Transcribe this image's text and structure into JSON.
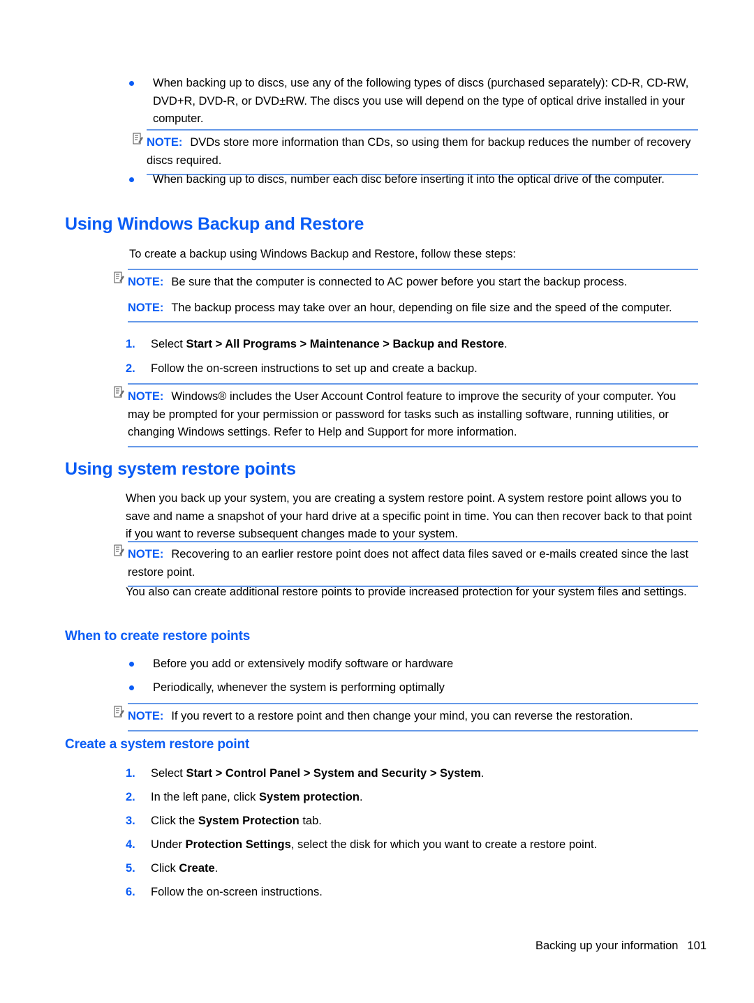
{
  "document": {
    "heading_color": "#0a5cf5",
    "note_border_color": "#6699e8",
    "bullets_top": [
      "When backing up to discs, use any of the following types of discs (purchased separately): CD-R, CD-RW, DVD+R, DVD-R, or DVD±RW. The discs you use will depend on the type of optical drive installed in your computer.",
      "When backing up to discs, number each disc before inserting it into the optical drive of the computer."
    ],
    "note_1": {
      "label": "NOTE:",
      "text": "DVDs store more information than CDs, so using them for backup reduces the number of recovery discs required.",
      "icon": "note-pencil-icon"
    },
    "section_backup_restore": {
      "title": "Using Windows Backup and Restore",
      "intro": "To create a backup using Windows Backup and Restore, follow these steps:",
      "note_a": {
        "label": "NOTE:",
        "text": "Be sure that the computer is connected to AC power before you start the backup process."
      },
      "note_b": {
        "label": "NOTE:",
        "text": "The backup process may take over an hour, depending on file size and the speed of the computer."
      },
      "steps": [
        {
          "number": "1.",
          "prefix": "Select ",
          "bold": "Start > All Programs > Maintenance > Backup and Restore",
          "suffix": "."
        },
        {
          "number": "2.",
          "prefix": "Follow the on-screen instructions to set up and create a backup.",
          "bold": "",
          "suffix": ""
        }
      ],
      "note_c": {
        "label": "NOTE:",
        "text": "Windows® includes the User Account Control feature to improve the security of your computer. You may be prompted for your permission or password for tasks such as installing software, running utilities, or changing Windows settings. Refer to Help and Support for more information."
      }
    },
    "section_restore_points": {
      "title": "Using system restore points",
      "para_1": "When you back up your system, you are creating a system restore point. A system restore point allows you to save and name a snapshot of your hard drive at a specific point in time. You can then recover back to that point if you want to reverse subsequent changes made to your system.",
      "note_a": {
        "label": "NOTE:",
        "text": "Recovering to an earlier restore point does not affect data files saved or e-mails created since the last restore point."
      },
      "para_2": "You also can create additional restore points to provide increased protection for your system files and settings."
    },
    "section_when_to_create": {
      "title": "When to create restore points",
      "bullets": [
        "Before you add or extensively modify software or hardware",
        "Periodically, whenever the system is performing optimally"
      ],
      "note_a": {
        "label": "NOTE:",
        "text": "If you revert to a restore point and then change your mind, you can reverse the restoration."
      }
    },
    "section_create_point": {
      "title": "Create a system restore point",
      "steps": [
        {
          "number": "1.",
          "prefix": "Select ",
          "bold": "Start > Control Panel > System and Security > System",
          "suffix": "."
        },
        {
          "number": "2.",
          "prefix": "In the left pane, click ",
          "bold": "System protection",
          "suffix": "."
        },
        {
          "number": "3.",
          "prefix": "Click the ",
          "bold": "System Protection",
          "suffix": " tab."
        },
        {
          "number": "4.",
          "prefix": "Under ",
          "bold": "Protection Settings",
          "suffix": ", select the disk for which you want to create a restore point."
        },
        {
          "number": "5.",
          "prefix": "Click ",
          "bold": "Create",
          "suffix": "."
        },
        {
          "number": "6.",
          "prefix": "Follow the on-screen instructions.",
          "bold": "",
          "suffix": ""
        }
      ]
    },
    "footer": {
      "title": "Backing up your information",
      "page_number": "101"
    }
  }
}
